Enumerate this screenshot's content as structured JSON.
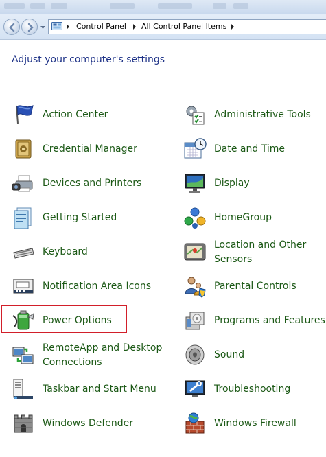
{
  "window": {
    "breadcrumb": [
      "Control Panel",
      "All Control Panel Items"
    ]
  },
  "heading": "Adjust your computer's settings",
  "items": {
    "left": [
      {
        "label": "Action Center",
        "icon": "flag-icon"
      },
      {
        "label": "Credential Manager",
        "icon": "credential-vault-icon"
      },
      {
        "label": "Devices and Printers",
        "icon": "printer-camera-icon"
      },
      {
        "label": "Getting Started",
        "icon": "getting-started-icon"
      },
      {
        "label": "Keyboard",
        "icon": "keyboard-icon"
      },
      {
        "label": "Notification Area Icons",
        "icon": "notification-area-icon"
      },
      {
        "label": "Power Options",
        "icon": "battery-icon",
        "selected": true
      },
      {
        "label1": "RemoteApp and Desktop",
        "label2": "Connections",
        "icon": "remoteapp-icon"
      },
      {
        "label": "Taskbar and Start Menu",
        "icon": "taskbar-icon"
      },
      {
        "label": "Windows Defender",
        "icon": "defender-castle-icon"
      }
    ],
    "right": [
      {
        "label": "Administrative Tools",
        "icon": "admin-tools-icon"
      },
      {
        "label": "Date and Time",
        "icon": "calendar-clock-icon"
      },
      {
        "label": "Display",
        "icon": "monitor-icon"
      },
      {
        "label": "HomeGroup",
        "icon": "homegroup-icon"
      },
      {
        "label1": "Location and Other",
        "label2": "Sensors",
        "icon": "location-sensor-icon"
      },
      {
        "label": "Parental Controls",
        "icon": "parental-controls-icon"
      },
      {
        "label": "Programs and Features",
        "icon": "programs-features-icon"
      },
      {
        "label": "Sound",
        "icon": "speaker-icon"
      },
      {
        "label": "Troubleshooting",
        "icon": "troubleshooting-icon"
      },
      {
        "label": "Windows Firewall",
        "icon": "firewall-icon"
      }
    ]
  },
  "colors": {
    "link": "#1c5916",
    "heading": "#1e3287",
    "highlight_border": "#d21f2a"
  }
}
